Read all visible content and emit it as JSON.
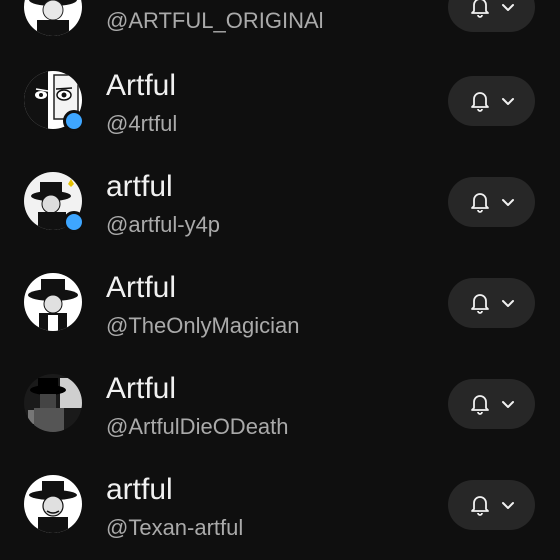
{
  "channels": [
    {
      "name": "",
      "handle": "@ARTFUL_ORIGINAl",
      "verified": false,
      "avatar_icon": "artful-avatar-icon"
    },
    {
      "name": "Artful",
      "handle": "@4rtful",
      "verified": true,
      "avatar_icon": "artful-avatar-icon"
    },
    {
      "name": "artful",
      "handle": "@artful-y4p",
      "verified": true,
      "avatar_icon": "artful-avatar-icon"
    },
    {
      "name": "Artful",
      "handle": "@TheOnlyMagician",
      "verified": false,
      "avatar_icon": "artful-avatar-icon"
    },
    {
      "name": "Artful",
      "handle": "@ArtfulDieODeath",
      "verified": false,
      "avatar_icon": "artful-avatar-icon"
    },
    {
      "name": "artful",
      "handle": "@Texan-artful",
      "verified": false,
      "avatar_icon": "artful-avatar-icon"
    }
  ],
  "icons": {
    "notification": "bell-icon",
    "dropdown": "chevron-down-icon",
    "verified": "verified-badge-icon"
  },
  "colors": {
    "background": "#0f0f0f",
    "button": "#272727",
    "primary_text": "#f1f1f1",
    "secondary_text": "#aaaaaa",
    "verified": "#3ea6ff"
  }
}
